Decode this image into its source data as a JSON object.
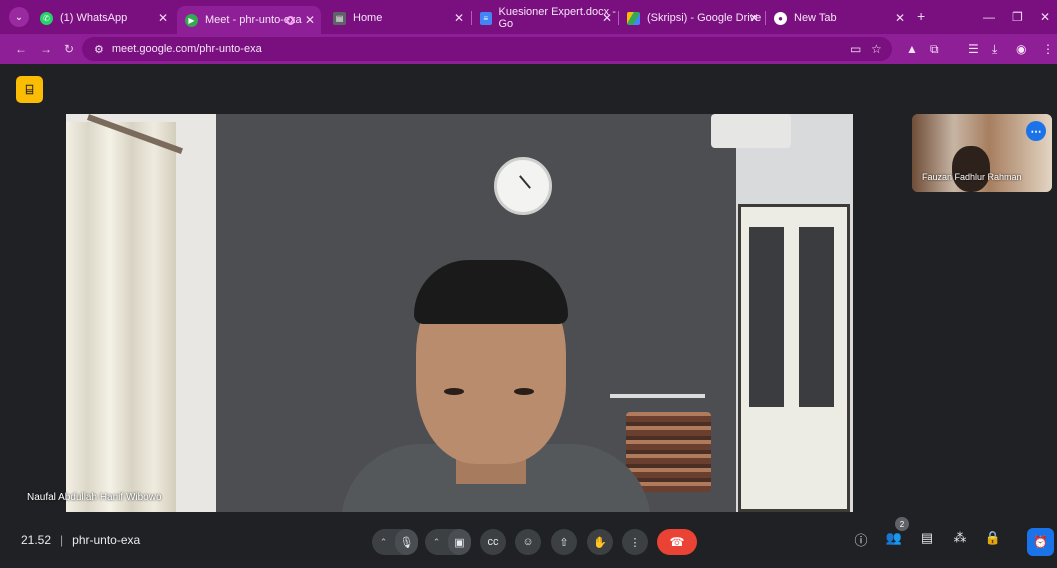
{
  "colors": {
    "frame": "#7a0f80",
    "toolbar": "#8f1f96",
    "meet_bg": "#202124",
    "end_call": "#ea4335",
    "accent": "#1a73e8"
  },
  "tabs": [
    {
      "title": "(1) WhatsApp",
      "icon": "whatsapp-icon"
    },
    {
      "title": "Meet - phr-unto-exa",
      "icon": "meet-icon"
    },
    {
      "title": "Home",
      "icon": "home-app-icon"
    },
    {
      "title": "Kuesioner Expert.docx - Go",
      "icon": "docs-icon"
    },
    {
      "title": "(Skripsi) - Google Drive",
      "icon": "drive-icon"
    },
    {
      "title": "New Tab",
      "icon": "chrome-icon"
    }
  ],
  "omnibox": {
    "url": "meet.google.com/phr-unto-exa"
  },
  "meeting": {
    "time": "21.52",
    "code": "phr-unto-exa",
    "main_speaker": "Naufal Abdullah Hanif Wibowo",
    "tile_participant": "Fauzan Fadhlur Rahman",
    "people_count": "2"
  }
}
